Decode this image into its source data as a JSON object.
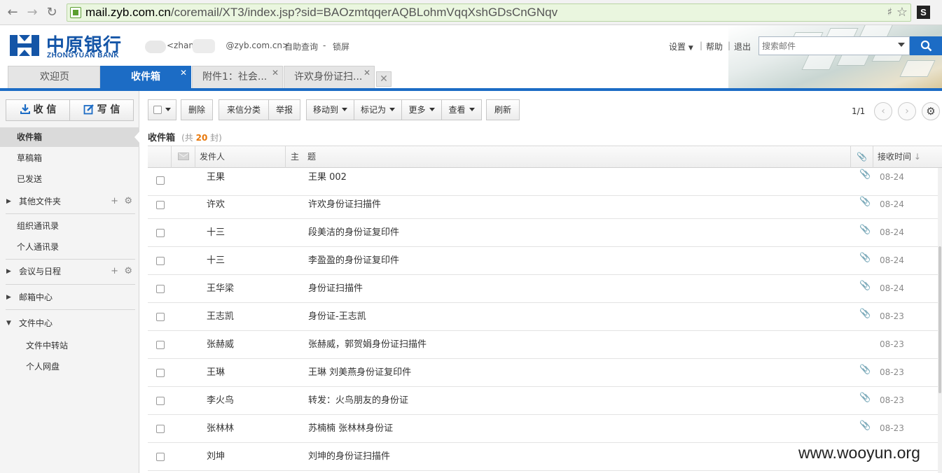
{
  "browser": {
    "url_host": "mail.zyb.com.cn",
    "url_path": "/coremail/XT3/index.jsp?sid=BAOzmtqqerAQBLohmVqqXshGDsCnGNqv",
    "extension_label": "S",
    "url_color": "#eaf6df"
  },
  "brand": {
    "name_cn": "中原银行",
    "name_en": "ZHONGYUAN BANK",
    "color": "#1455a7"
  },
  "user": {
    "email_prefix": "<zhang",
    "email_suffix": "@zyb.com.cn>",
    "self_query": "自助查询",
    "dash": "-",
    "lock": "锁屏"
  },
  "top_links": {
    "settings": "设置",
    "help": "帮助",
    "logout": "退出"
  },
  "search": {
    "placeholder": "搜索邮件"
  },
  "tabs": [
    {
      "label": "欢迎页"
    },
    {
      "label": "收件箱"
    },
    {
      "label": "附件1：社会..."
    },
    {
      "label": "许欢身份证扫..."
    }
  ],
  "sidebar": {
    "receive": "收 信",
    "write": "写 信",
    "items": {
      "inbox": "收件箱",
      "drafts": "草稿箱",
      "sent": "已发送",
      "other": "其他文件夹",
      "org_contacts": "组织通讯录",
      "personal_contacts": "个人通讯录",
      "meetings": "会议与日程",
      "mailbox_center": "邮箱中心",
      "file_center": "文件中心",
      "file_transfer": "文件中转站",
      "personal_disk": "个人网盘"
    }
  },
  "toolbar": {
    "delete": "删除",
    "sort": "来信分类",
    "report": "举报",
    "move": "移动到",
    "mark": "标记为",
    "more": "更多",
    "view": "查看",
    "refresh": "刷新"
  },
  "pager": {
    "text": "1/1"
  },
  "folder": {
    "title": "收件箱",
    "count_prefix": "(共",
    "count": "20",
    "count_suffix": "封)"
  },
  "columns": {
    "sender": "发件人",
    "subject": "主　题",
    "date": "接收时间"
  },
  "emails": [
    {
      "sender": "王果",
      "subject": "王果 002",
      "date": "08-24",
      "attachment": true
    },
    {
      "sender": "许欢",
      "subject": "许欢身份证扫描件",
      "date": "08-24",
      "attachment": true
    },
    {
      "sender": "十三",
      "subject": "段美洁的身份证复印件",
      "date": "08-24",
      "attachment": true
    },
    {
      "sender": "十三",
      "subject": "李盈盈的身份证复印件",
      "date": "08-24",
      "attachment": true
    },
    {
      "sender": "王华梁",
      "subject": "身份证扫描件",
      "date": "08-24",
      "attachment": true
    },
    {
      "sender": "王志凯",
      "subject": "身份证-王志凯",
      "date": "08-23",
      "attachment": true
    },
    {
      "sender": "张赫威",
      "subject": "张赫威，郭贺娟身份证扫描件",
      "date": "08-23",
      "attachment": false
    },
    {
      "sender": "王琳",
      "subject": "王琳 刘美燕身份证复印件",
      "date": "08-23",
      "attachment": true
    },
    {
      "sender": "李火鸟",
      "subject": "转发：火鸟朋友的身份证",
      "date": "08-23",
      "attachment": true
    },
    {
      "sender": "张林林",
      "subject": "苏楠楠 张林林身份证",
      "date": "08-23",
      "attachment": true
    },
    {
      "sender": "刘坤",
      "subject": "刘坤的身份证扫描件",
      "date": "",
      "attachment": false
    }
  ],
  "watermark": "www.wooyun.org",
  "accent_color": "#1c6cc5",
  "count_color": "#e8780b"
}
